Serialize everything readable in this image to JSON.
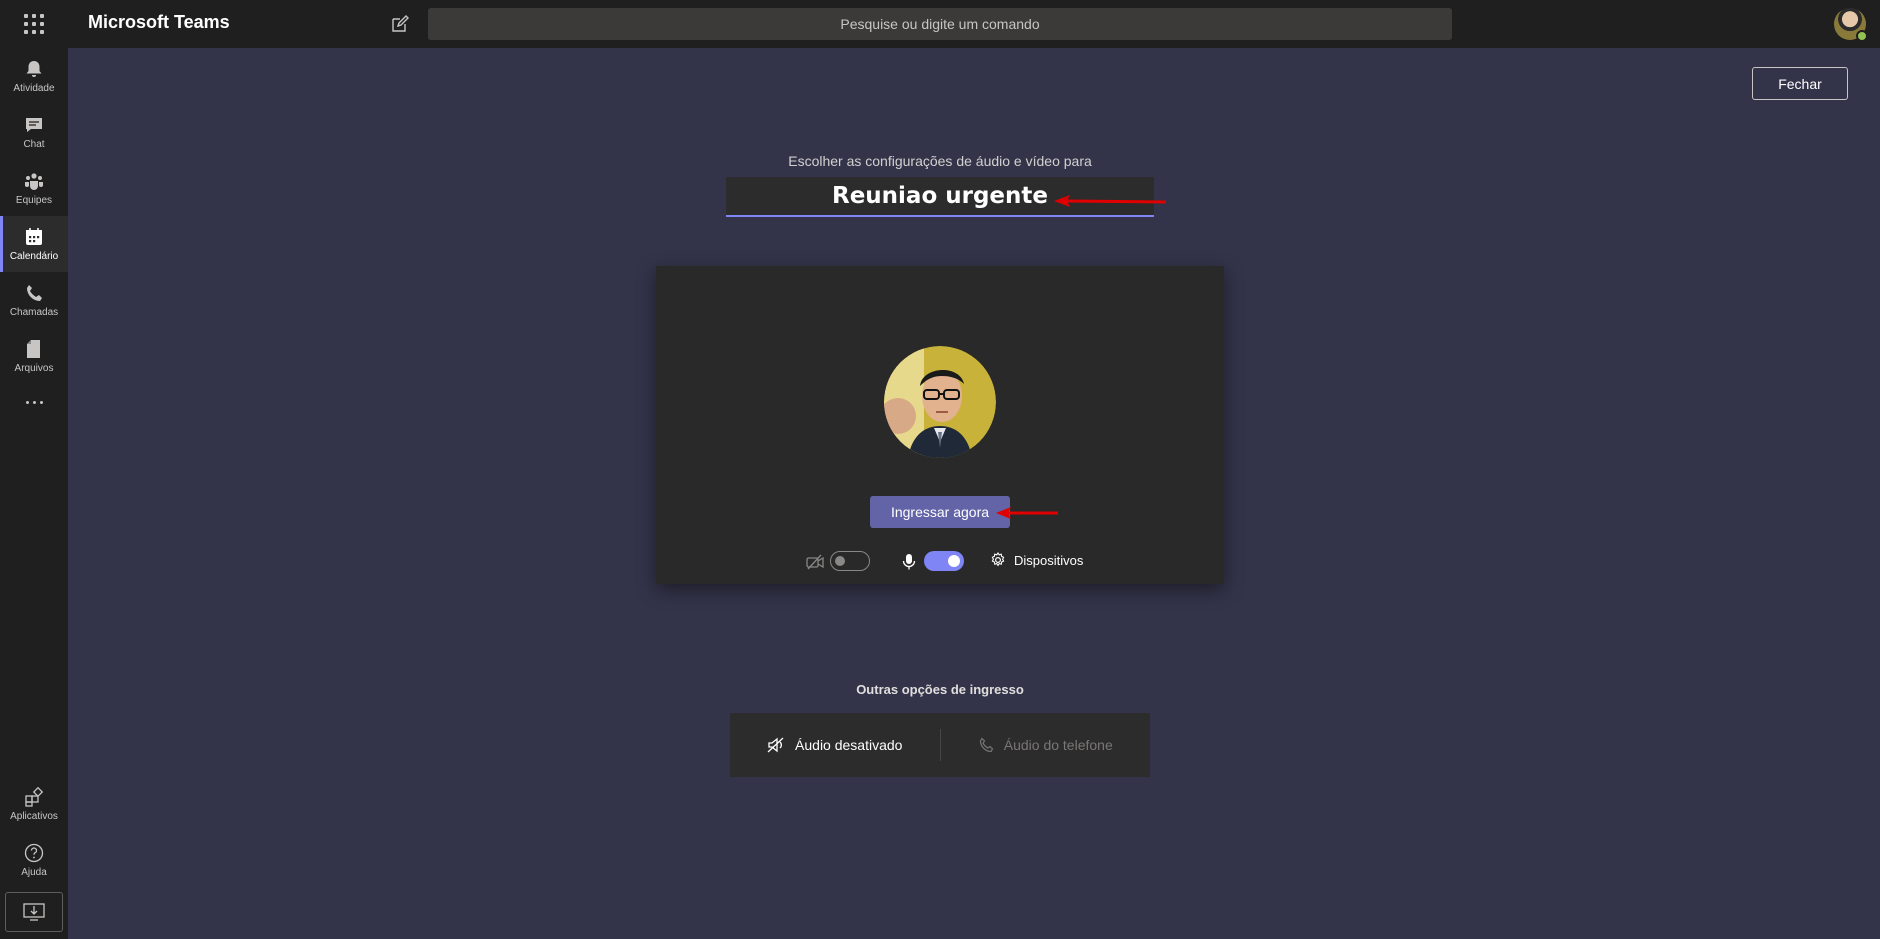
{
  "app": {
    "title": "Microsoft Teams"
  },
  "search": {
    "placeholder": "Pesquise ou digite um comando"
  },
  "rail": {
    "items": [
      {
        "label": "Atividade",
        "icon": "bell-icon"
      },
      {
        "label": "Chat",
        "icon": "chat-icon"
      },
      {
        "label": "Equipes",
        "icon": "teams-icon"
      },
      {
        "label": "Calendário",
        "icon": "calendar-icon",
        "active": true
      },
      {
        "label": "Chamadas",
        "icon": "phone-icon"
      },
      {
        "label": "Arquivos",
        "icon": "file-icon"
      }
    ],
    "bottom": [
      {
        "label": "Aplicativos",
        "icon": "apps-icon"
      },
      {
        "label": "Ajuda",
        "icon": "help-icon"
      }
    ]
  },
  "header": {
    "close_label": "Fechar"
  },
  "prejoin": {
    "subtitle": "Escolher as configurações de áudio e vídeo para",
    "meeting_title": "Reuniao urgente",
    "join_label": "Ingressar agora",
    "devices_label": "Dispositivos",
    "camera_on": false,
    "mic_on": true
  },
  "other_options": {
    "label": "Outras opções de ingresso",
    "audio_off_label": "Áudio desativado",
    "phone_audio_label": "Áudio do telefone"
  },
  "colors": {
    "accent": "#6264a7",
    "toggle_on": "#7f85f5",
    "arrow": "#e00000",
    "presence": "#92c353"
  }
}
